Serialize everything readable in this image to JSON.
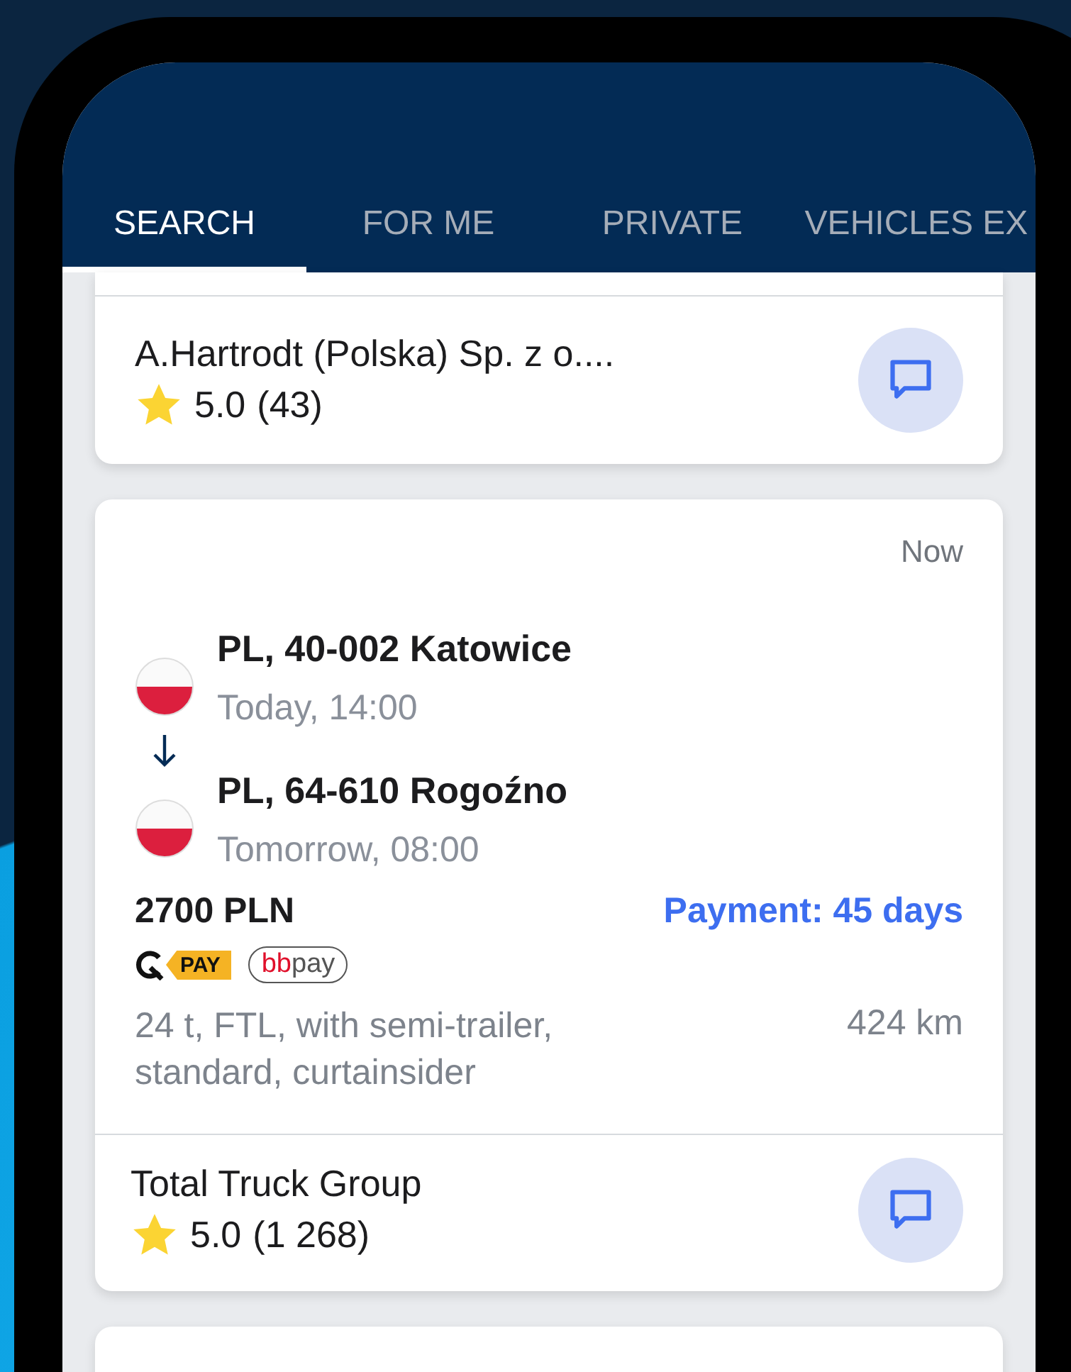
{
  "tabs": [
    {
      "label": "SEARCH",
      "selected": true
    },
    {
      "label": "FOR ME",
      "selected": false
    },
    {
      "label": "PRIVATE",
      "selected": false
    },
    {
      "label": "VEHICLES EX",
      "selected": false
    }
  ],
  "partial_card": {
    "company": "A.Hartrodt (Polska) Sp. z o....",
    "rating": "5.0",
    "reviews": "(43)"
  },
  "offer": {
    "posted": "Now",
    "stops": [
      {
        "place": "PL, 40-002 Katowice",
        "time": "Today, 14:00"
      },
      {
        "place": "PL, 64-610 Rogoźno",
        "time": "Tomorrow, 08:00"
      }
    ],
    "price": "2700 PLN",
    "payment": "Payment: 45 days",
    "pay_badges": [
      {
        "kind": "qpay",
        "text": "PAY"
      },
      {
        "kind": "bbpay",
        "text": "bbpay"
      }
    ],
    "details": "24 t, FTL, with semi-trailer, standard, curtainsider",
    "distance": "424 km",
    "company": "Total Truck Group",
    "rating": "5.0",
    "reviews": "(1 268)"
  }
}
